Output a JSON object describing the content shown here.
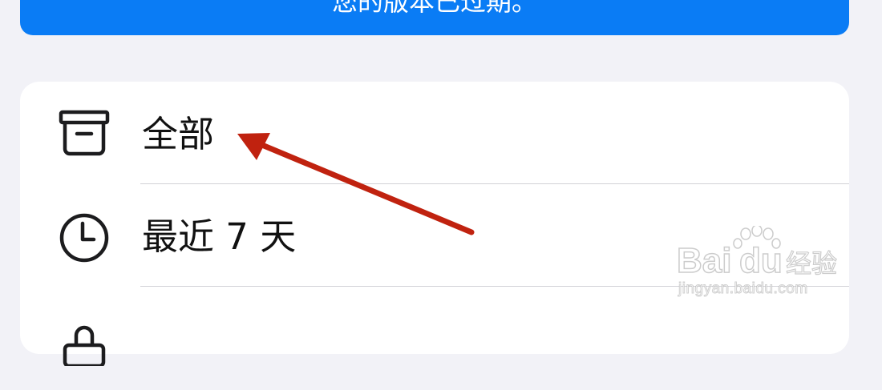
{
  "banner": {
    "text": "您的版本已过期。",
    "color": "#0a7cf5"
  },
  "list": {
    "items": [
      {
        "label": "全部",
        "icon": "archive-box-icon"
      },
      {
        "label": "最近 7 天",
        "icon": "clock-icon"
      },
      {
        "label": "",
        "icon": "lock-icon"
      }
    ]
  },
  "annotation": {
    "arrow_color": "#c0220f"
  },
  "watermark": {
    "brand": "Baidu经验",
    "url": "jingyan.baidu.com"
  }
}
